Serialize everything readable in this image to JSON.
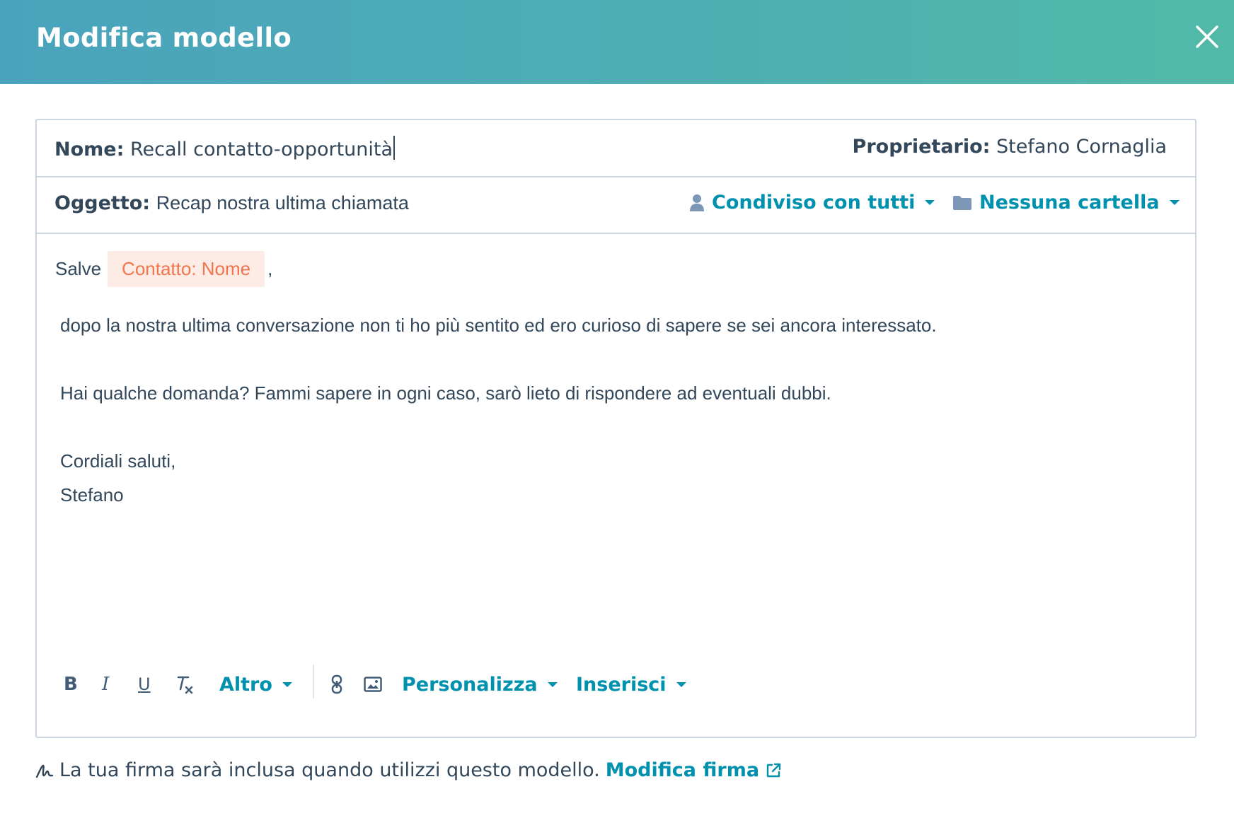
{
  "header": {
    "title": "Modifica modello"
  },
  "fields": {
    "name_label": "Nome:",
    "name_value": "Recall contatto-opportunità",
    "owner_label": "Proprietario:",
    "owner_value": "Stefano Cornaglia",
    "subject_label": "Oggetto:",
    "subject_value": "Recap nostra ultima chiamata",
    "sharing_label": "Condiviso con tutti",
    "folder_label": "Nessuna cartella"
  },
  "body": {
    "greeting": "Salve",
    "token": "Contatto: Nome",
    "comma": ",",
    "paragraph1": "dopo la nostra ultima conversazione non ti ho più sentito ed ero curioso di sapere se sei ancora interessato.",
    "paragraph2": "Hai qualche domanda? Fammi sapere in ogni caso, sarò lieto di rispondere ad eventuali dubbi.",
    "closing": "Cordiali saluti,",
    "signature_name": "Stefano"
  },
  "toolbar": {
    "bold": "B",
    "italic": "I",
    "underline": "U",
    "more_label": "Altro",
    "personalize_label": "Personalizza",
    "insert_label": "Inserisci"
  },
  "footer": {
    "note": "La tua firma sarà inclusa quando utilizzi questo modello.",
    "edit_signature_label": "Modifica firma"
  },
  "colors": {
    "header_start": "#4aa3bd",
    "header_end": "#52b9a8",
    "link": "#0091ae",
    "token_bg": "#fdece6",
    "token_text": "#f2754e",
    "text": "#33475b",
    "border": "#cbd6e2"
  }
}
